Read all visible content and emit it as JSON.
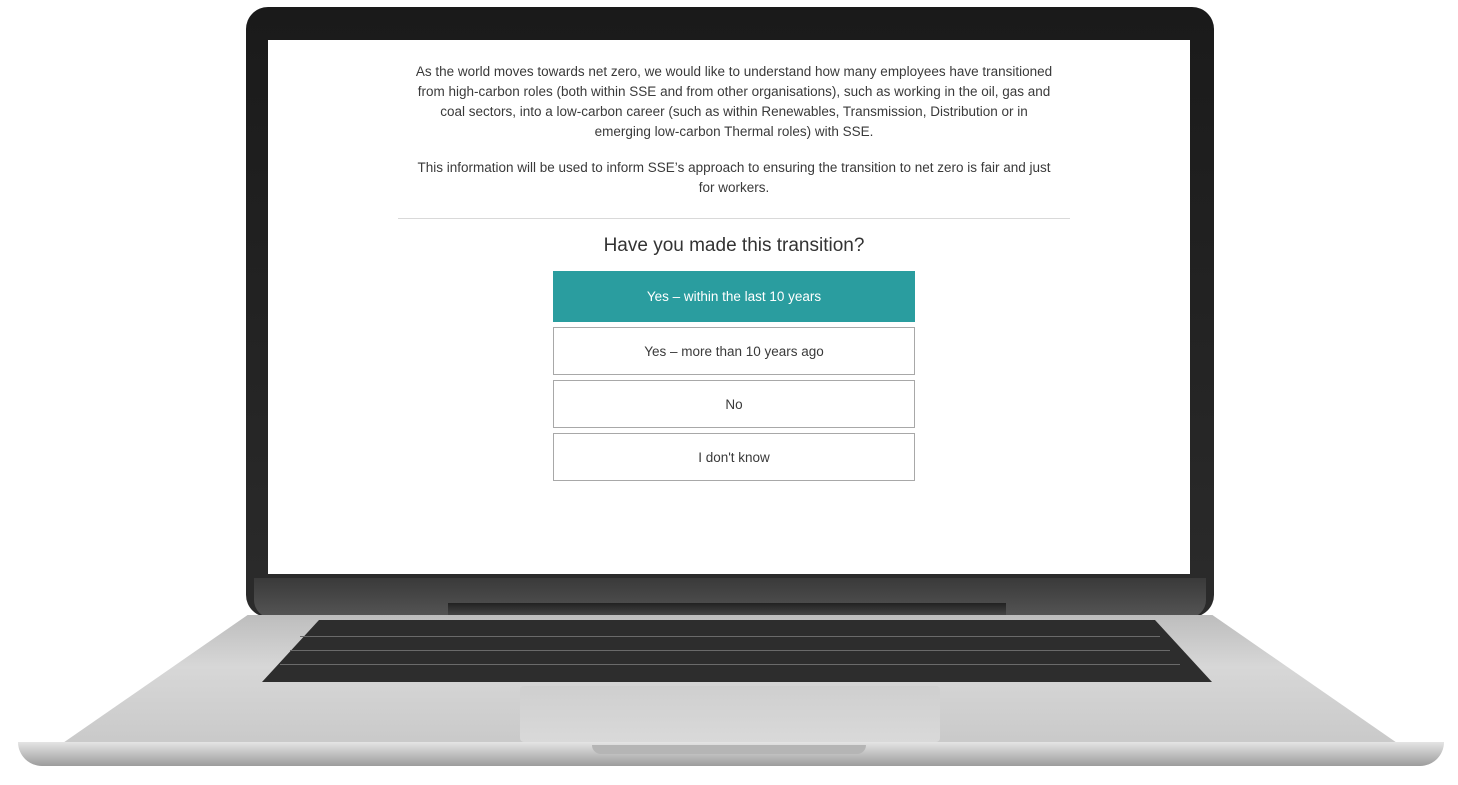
{
  "survey": {
    "intro_paragraph_1": "As the world moves towards net zero, we would like to understand how many employees have transitioned from high-carbon roles (both within SSE and from other organisations), such as working in the oil, gas and coal sectors, into a low-carbon career (such as within Renewables, Transmission, Distribution or in emerging low-carbon Thermal roles) with SSE.",
    "intro_paragraph_2": "This information will be used to inform SSE’s approach to ensuring the transition to net zero is fair and just for workers.",
    "question": "Have you made this transition?",
    "options": [
      {
        "label": "Yes – within the last 10 years",
        "selected": true
      },
      {
        "label": "Yes – more than 10 years ago",
        "selected": false
      },
      {
        "label": "No",
        "selected": false
      },
      {
        "label": "I don't know",
        "selected": false
      }
    ],
    "selected_color": "#2a9d9f"
  }
}
